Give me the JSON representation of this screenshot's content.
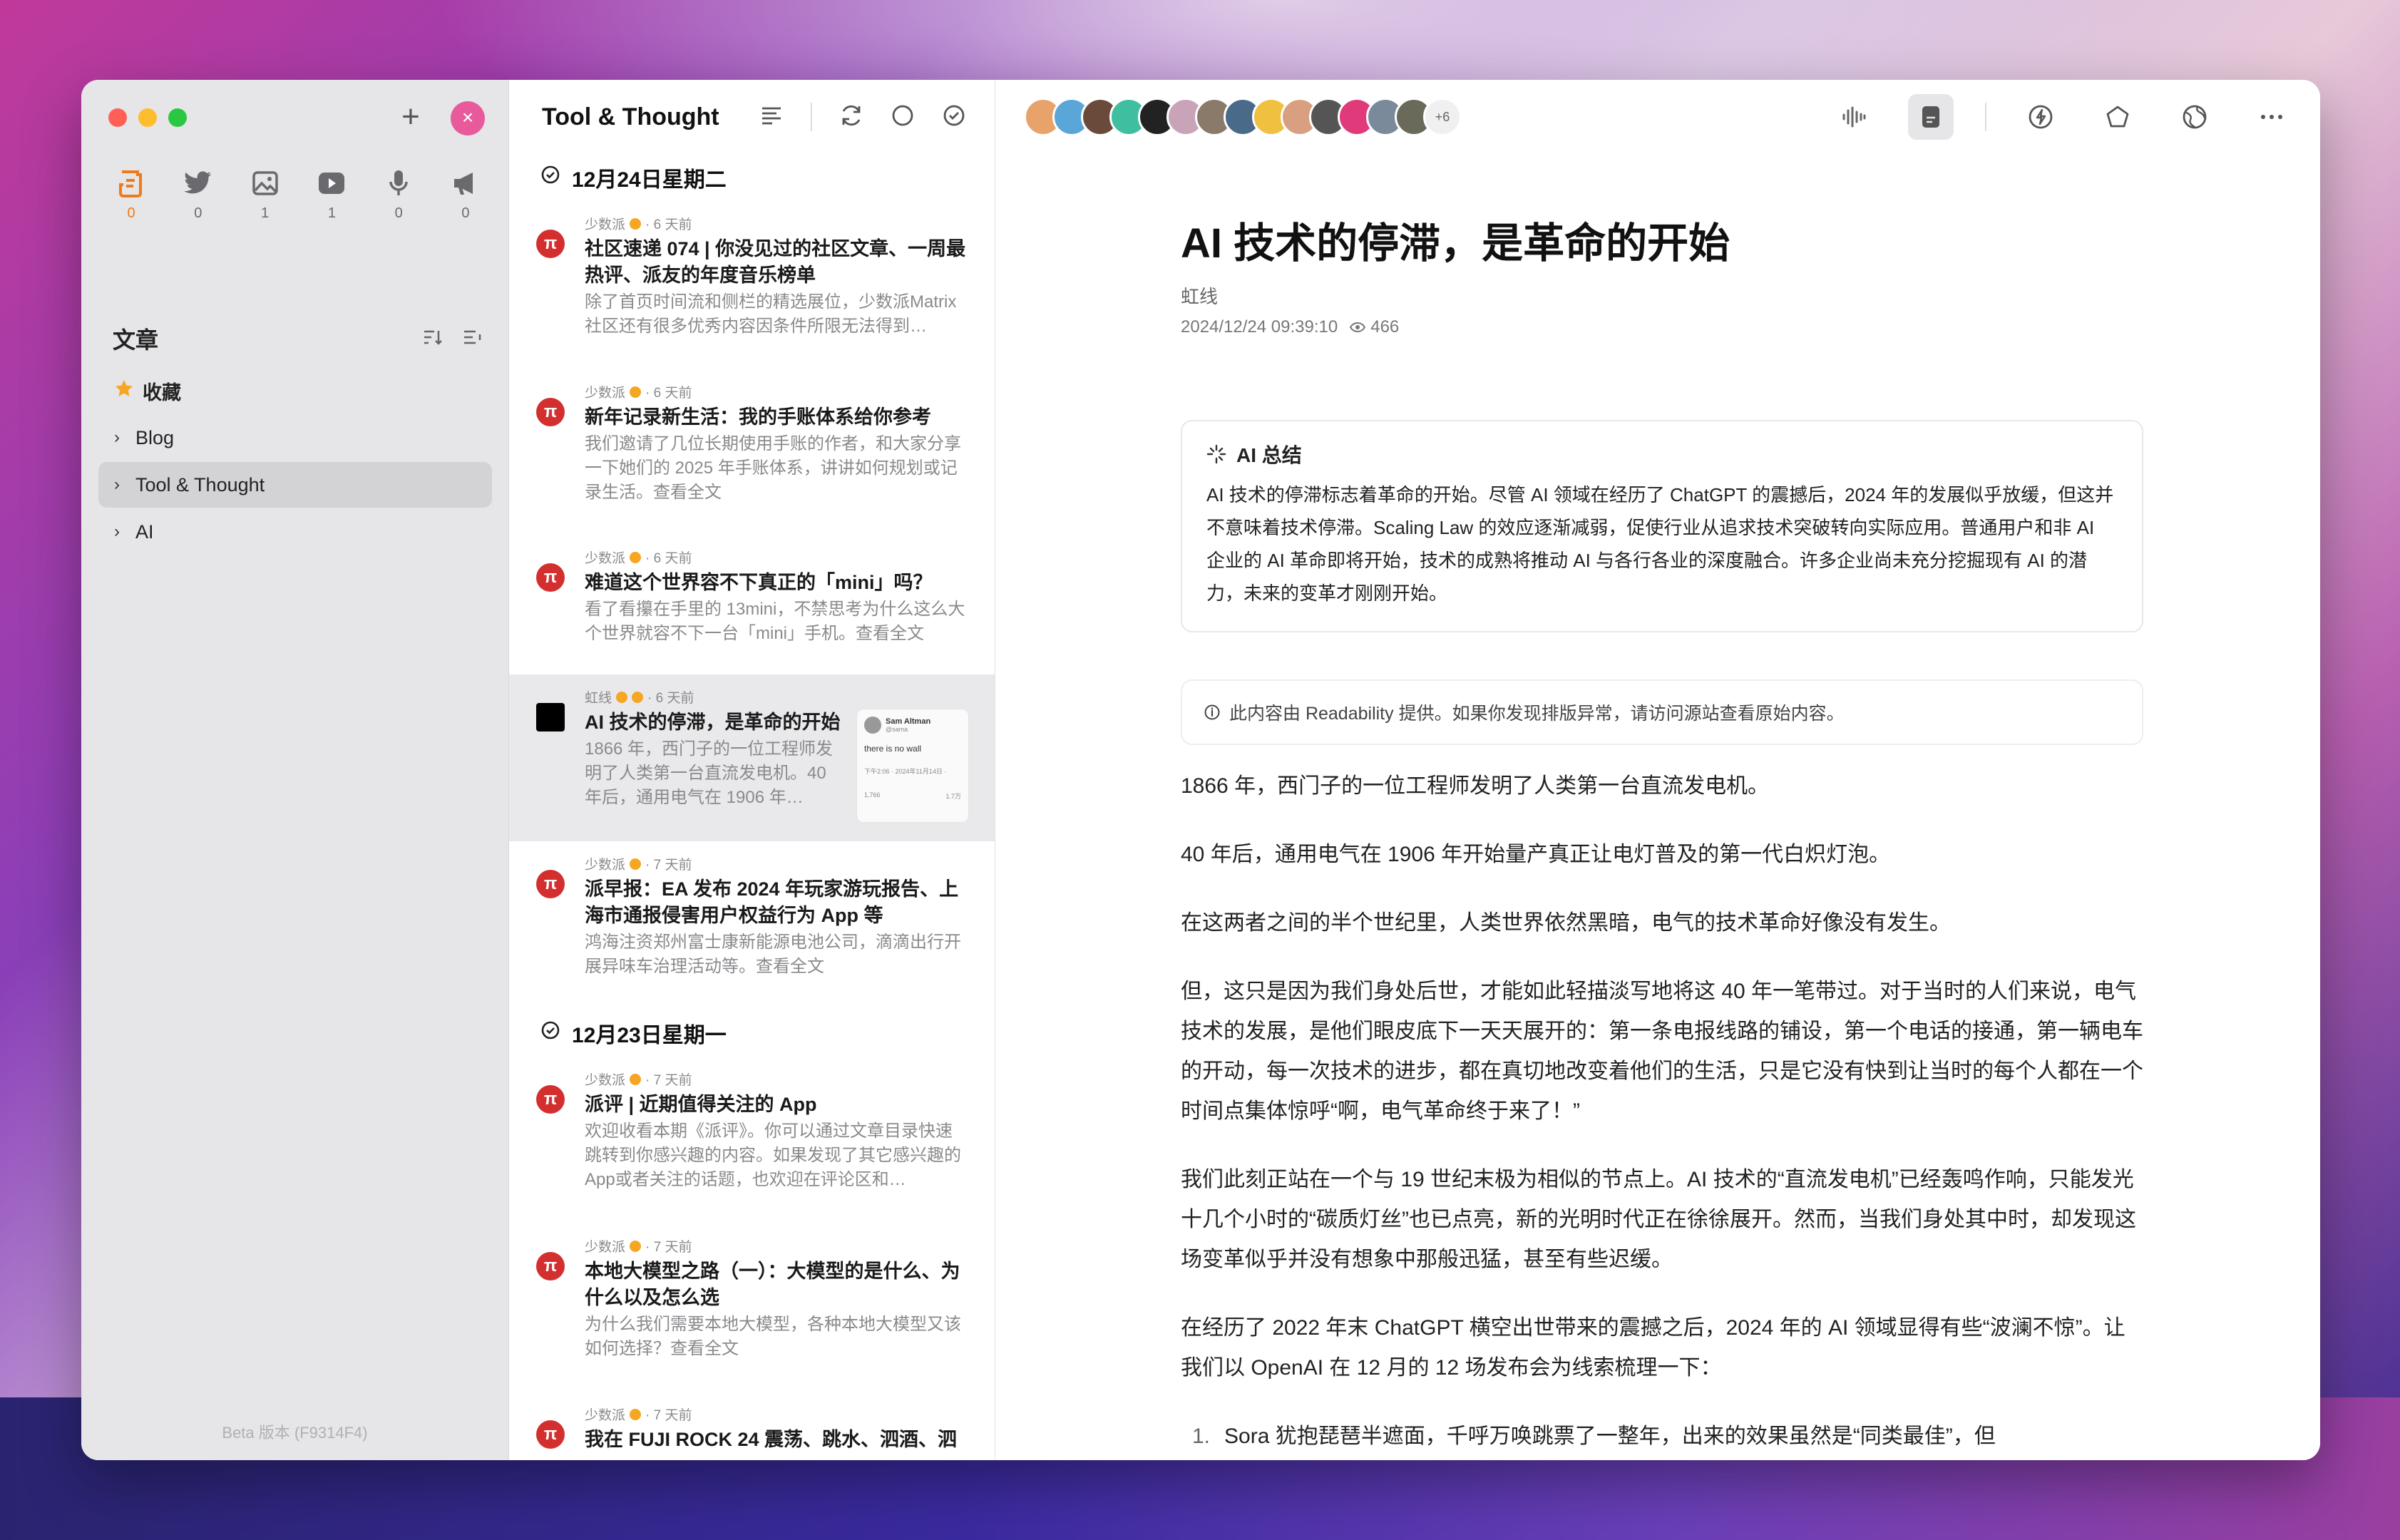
{
  "sidebar": {
    "sources": [
      {
        "icon": "article-icon",
        "count": "0"
      },
      {
        "icon": "twitter-icon",
        "count": "0"
      },
      {
        "icon": "image-icon",
        "count": "1"
      },
      {
        "icon": "video-icon",
        "count": "1"
      },
      {
        "icon": "podcast-icon",
        "count": "0"
      },
      {
        "icon": "announcement-icon",
        "count": "0"
      }
    ],
    "section_title": "文章",
    "items": [
      {
        "label": "收藏"
      },
      {
        "label": "Blog"
      },
      {
        "label": "Tool & Thought"
      },
      {
        "label": "AI"
      }
    ],
    "beta": "Beta 版本 (F9314F4)"
  },
  "list": {
    "title": "Tool & Thought",
    "groups": [
      {
        "date": "12月24日星期二"
      },
      {
        "date": "12月23日星期一"
      }
    ],
    "articles": [
      {
        "source": "少数派",
        "time": "· 6 天前",
        "title": "社区速递 074 | 你没见过的社区文章、一周最热评、派友的年度音乐榜单",
        "summary": "除了首页时间流和侧栏的精选展位，少数派Matrix社区还有很多优秀内容因条件所限无法得到…"
      },
      {
        "source": "少数派",
        "time": "· 6 天前",
        "title": "新年记录新生活：我的手账体系给你参考",
        "summary": "我们邀请了几位长期使用手账的作者，和大家分享一下她们的 2025 年手账体系，讲讲如何规划或记录生活。查看全文"
      },
      {
        "source": "少数派",
        "time": "· 6 天前",
        "title": "难道这个世界容不下真正的「mini」吗？",
        "summary": "看了看攥在手里的 13mini，不禁思考为什么这么大个世界就容不下一台「mini」手机。查看全文"
      },
      {
        "source": "虹线",
        "time": "· 6 天前",
        "title": "AI 技术的停滞，是革命的开始",
        "summary": "1866 年，西门子的一位工程师发明了人类第一台直流发电机。40 年后，通用电气在 1906 年…",
        "thumb_name": "Sam Altman",
        "thumb_handle": "@sama",
        "thumb_text": "there is no wall",
        "thumb_time": "下午2:06 · 2024年11月14日 ·",
        "thumb_stat1": "1,766",
        "thumb_stat2": "1.7万"
      },
      {
        "source": "少数派",
        "time": "· 7 天前",
        "title": "派早报：EA 发布 2024 年玩家游玩报告、上海市通报侵害用户权益行为 App 等",
        "summary": "鸿海注资郑州富士康新能源电池公司，滴滴出行开展异味车治理活动等。查看全文"
      },
      {
        "source": "少数派",
        "time": "· 7 天前",
        "title": "派评 | 近期值得关注的 App",
        "summary": "欢迎收看本期《派评》。你可以通过文章目录快速跳转到你感兴趣的内容。如果发现了其它感兴趣的App或者关注的话题，也欢迎在评论区和…"
      },
      {
        "source": "少数派",
        "time": "· 7 天前",
        "title": "本地大模型之路（一）：大模型的是什么、为什么以及怎么选",
        "summary": "为什么我们需要本地大模型，各种本地大模型又该如何选择？查看全文"
      },
      {
        "source": "少数派",
        "time": "· 7 天前",
        "title": "我在 FUJI ROCK 24 震荡、跳水、泗酒、泗",
        "summary": ""
      }
    ]
  },
  "reader": {
    "more_avatars": "+6",
    "title": "AI 技术的停滞，是革命的开始",
    "author": "虹线",
    "datetime": "2024/12/24 09:39:10",
    "views": "466",
    "ai_title": "AI 总结",
    "ai_text": "AI 技术的停滞标志着革命的开始。尽管 AI 领域在经历了 ChatGPT 的震撼后，2024 年的发展似乎放缓，但这并不意味着技术停滞。Scaling Law 的效应逐渐减弱，促使行业从追求技术突破转向实际应用。普通用户和非 AI 企业的 AI 革命即将开始，技术的成熟将推动 AI 与各行各业的深度融合。许多企业尚未充分挖掘现有 AI 的潜力，未来的变革才刚刚开始。",
    "notice": "此内容由 Readability 提供。如果你发现排版异常，请访问源站查看原始内容。",
    "paragraphs": [
      "1866 年，西门子的一位工程师发明了人类第一台直流发电机。",
      "40 年后，通用电气在 1906 年开始量产真正让电灯普及的第一代白炽灯泡。",
      "在这两者之间的半个世纪里，人类世界依然黑暗，电气的技术革命好像没有发生。",
      "但，这只是因为我们身处后世，才能如此轻描淡写地将这 40 年一笔带过。对于当时的人们来说，电气技术的发展，是他们眼皮底下一天天展开的：第一条电报线路的铺设，第一个电话的接通，第一辆电车的开动，每一次技术的进步，都在真切地改变着他们的生活，只是它没有快到让当时的每个人都在一个时间点集体惊呼“啊，电气革命终于来了！”",
      "我们此刻正站在一个与 19 世纪末极为相似的节点上。AI 技术的“直流发电机”已经轰鸣作响，只能发光十几个小时的“碳质灯丝”也已点亮，新的光明时代正在徐徐展开。然而，当我们身处其中时，却发现这场变革似乎并没有想象中那般迅猛，甚至有些迟缓。",
      "在经历了 2022 年末 ChatGPT 横空出世带来的震撼之后，2024 年的 AI 领域显得有些“波澜不惊”。让我们以 OpenAI 在 12 月的 12 场发布会为线索梳理一下："
    ],
    "list_item_num": "1.",
    "list_item": "Sora 犹抱琵琶半遮面，千呼万唤跳票了一整年，出来的效果虽然是“同类最佳”，但"
  },
  "colors": {
    "accent": "#f07a1a",
    "pink": "#e85a9c",
    "pi_red": "#d32f2f"
  }
}
